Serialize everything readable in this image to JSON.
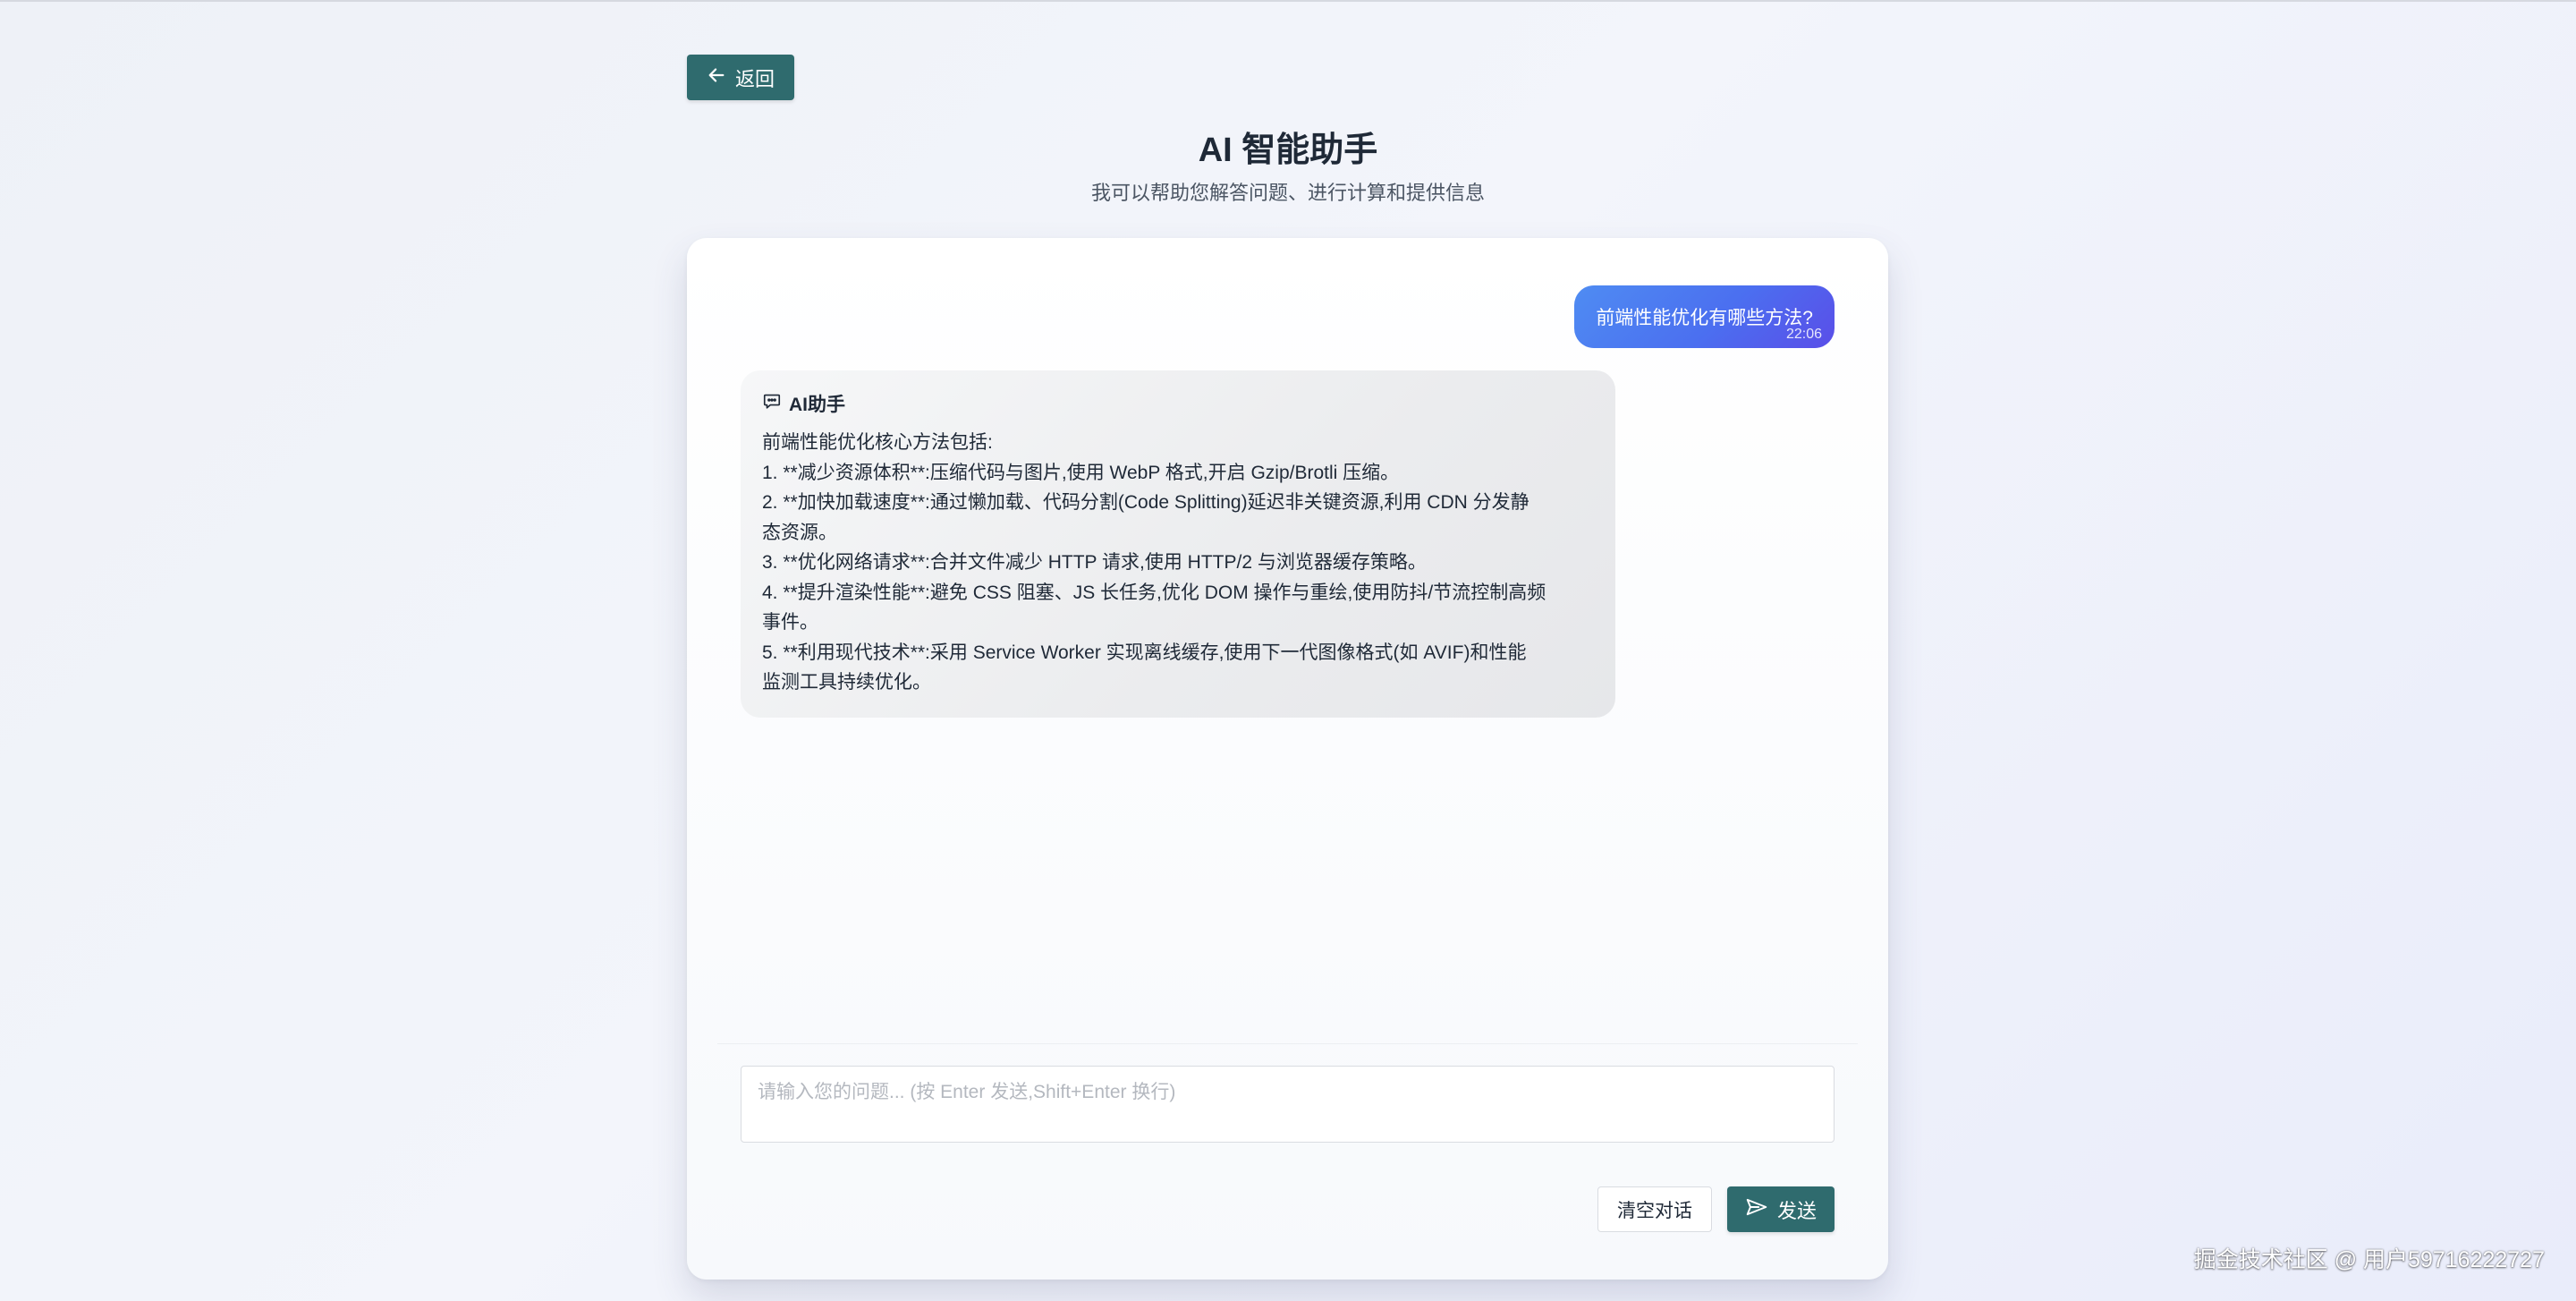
{
  "header": {
    "back_label": "返回",
    "title": "AI 智能助手",
    "subtitle": "我可以帮助您解答问题、进行计算和提供信息"
  },
  "messages": {
    "user": {
      "text": "前端性能优化有哪些方法?",
      "time": "22:06"
    },
    "assistant": {
      "name": "AI助手",
      "lines": [
        "前端性能优化核心方法包括:",
        "1. **减少资源体积**:压缩代码与图片,使用 WebP 格式,开启 Gzip/Brotli 压缩。",
        "2. **加快加载速度**:通过懒加载、代码分割(Code Splitting)延迟非关键资源,利用 CDN 分发静",
        "态资源。",
        "3. **优化网络请求**:合并文件减少 HTTP 请求,使用 HTTP/2 与浏览器缓存策略。",
        "4. **提升渲染性能**:避免 CSS 阻塞、JS 长任务,优化 DOM 操作与重绘,使用防抖/节流控制高频",
        "事件。",
        "5. **利用现代技术**:采用 Service Worker 实现离线缓存,使用下一代图像格式(如 AVIF)和性能",
        "监测工具持续优化。"
      ]
    }
  },
  "composer": {
    "placeholder": "请输入您的问题... (按 Enter 发送,Shift+Enter 换行)",
    "value": "",
    "clear_label": "清空对话",
    "send_label": "发送"
  },
  "watermark": "掘金技术社区 @ 用户59716222727",
  "icons": {
    "back": "arrow-left-icon",
    "assistant": "chat-bubble-icon",
    "send": "paper-plane-icon"
  },
  "colors": {
    "primary": "#2f6b6e",
    "user_bubble_start": "#4f8cf2",
    "user_bubble_end": "#5a4ee8",
    "assistant_bubble": "#ebecee"
  }
}
